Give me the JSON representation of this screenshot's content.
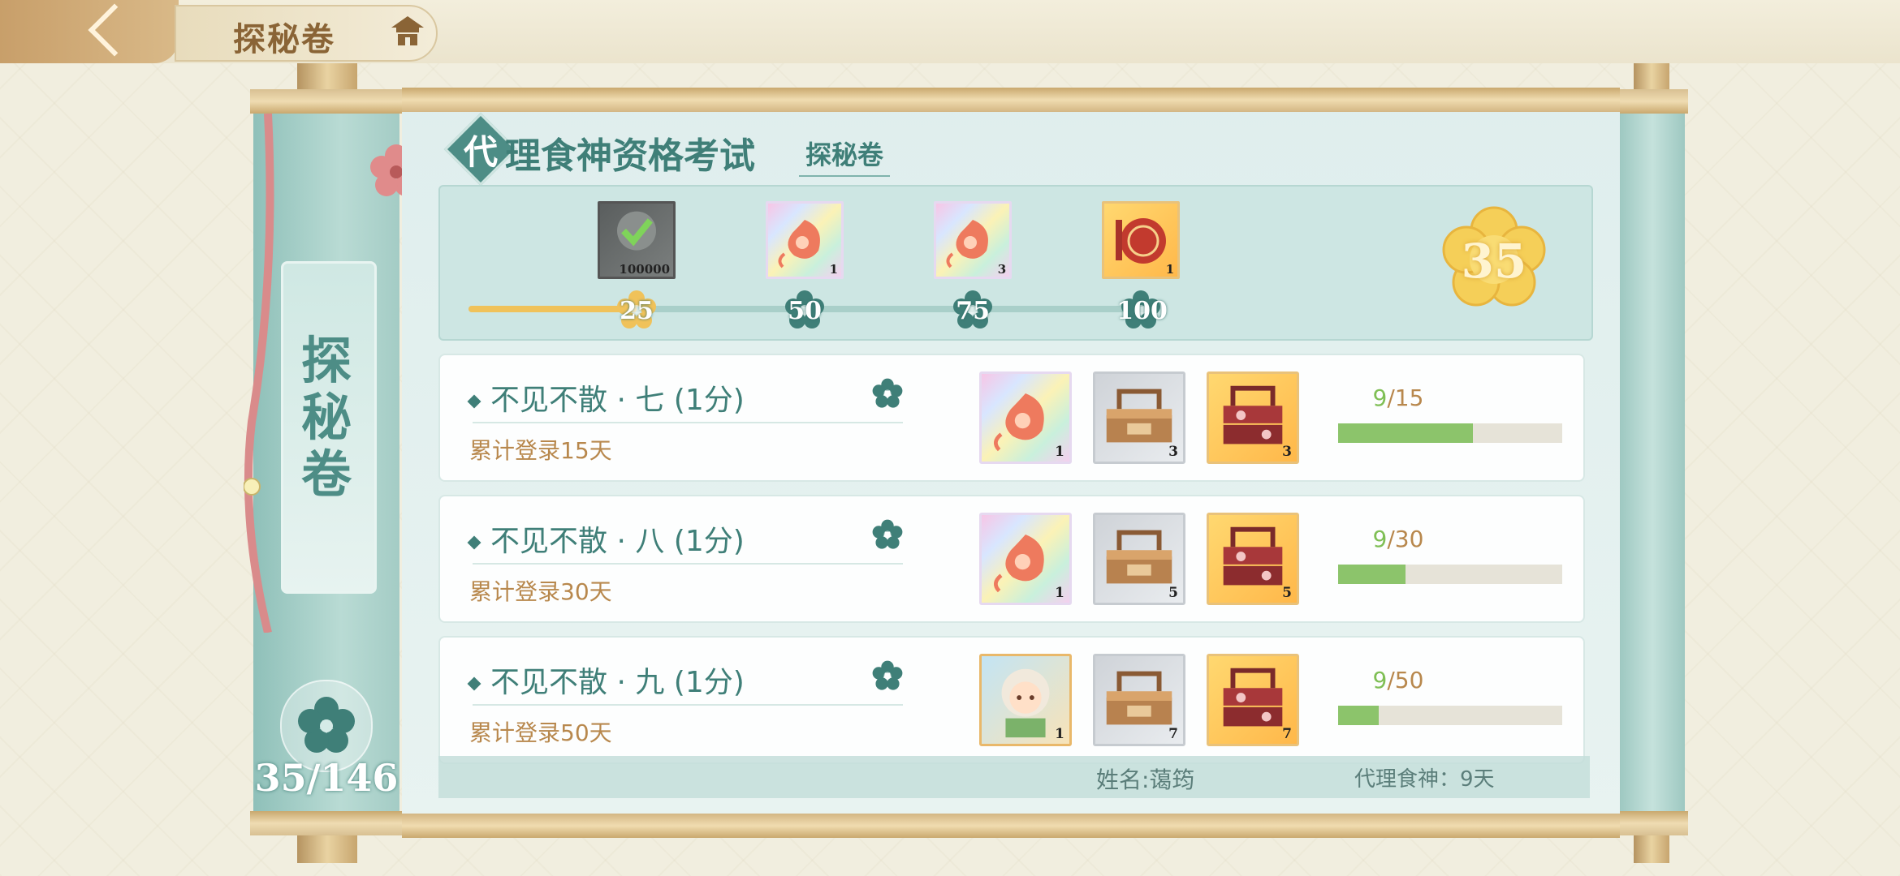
{
  "header": {
    "title": "探秘卷",
    "back_icon": "back-chevron-icon",
    "home_icon": "pavilion-icon"
  },
  "side": {
    "label": "探秘卷",
    "count": "35/146",
    "flower_icon": "plum-flower-icon"
  },
  "main": {
    "heading_first": "代",
    "heading": "理食神资格考试",
    "subheading": "探秘卷",
    "current_points": "35",
    "progress_fraction": 0.26
  },
  "milestones": [
    {
      "value": "25",
      "reached": true,
      "reward_icon": "check-token-icon",
      "reward_count": "100000",
      "art": "dark"
    },
    {
      "value": "50",
      "reached": false,
      "reward_icon": "spirit-flame-icon",
      "reward_count": "1",
      "art": "rainbow"
    },
    {
      "value": "75",
      "reached": false,
      "reward_icon": "spirit-flame-icon",
      "reward_count": "3",
      "art": "rainbow"
    },
    {
      "value": "100",
      "reached": false,
      "reward_icon": "red-seal-icon",
      "reward_count": "1",
      "art": "gold"
    }
  ],
  "tasks": [
    {
      "name": "不见不散 · 七 (1分)",
      "desc": "累计登录15天",
      "current": "9",
      "total": "/15",
      "fraction": 0.6,
      "rewards": [
        {
          "icon": "spirit-flame-icon",
          "count": "1",
          "art": "rainbow"
        },
        {
          "icon": "wooden-box-icon",
          "count": "3",
          "art": "grey"
        },
        {
          "icon": "red-lunchbox-icon",
          "count": "3",
          "art": "gold"
        }
      ]
    },
    {
      "name": "不见不散 · 八 (1分)",
      "desc": "累计登录30天",
      "current": "9",
      "total": "/30",
      "fraction": 0.3,
      "rewards": [
        {
          "icon": "spirit-flame-icon",
          "count": "1",
          "art": "rainbow"
        },
        {
          "icon": "wooden-box-icon",
          "count": "5",
          "art": "grey"
        },
        {
          "icon": "red-lunchbox-icon",
          "count": "5",
          "art": "gold"
        }
      ]
    },
    {
      "name": "不见不散 · 九 (1分)",
      "desc": "累计登录50天",
      "current": "9",
      "total": "/50",
      "fraction": 0.18,
      "rewards": [
        {
          "icon": "character-portrait-icon",
          "count": "1",
          "art": "char"
        },
        {
          "icon": "wooden-box-icon",
          "count": "7",
          "art": "grey"
        },
        {
          "icon": "red-lunchbox-icon",
          "count": "7",
          "art": "gold"
        }
      ]
    }
  ],
  "footer": {
    "name": "姓名:蔼筠",
    "days": "代理食神：9天"
  },
  "colors": {
    "teal": "#3f7f78",
    "gold": "#f0c25a",
    "progress_green": "#8cc46b"
  }
}
